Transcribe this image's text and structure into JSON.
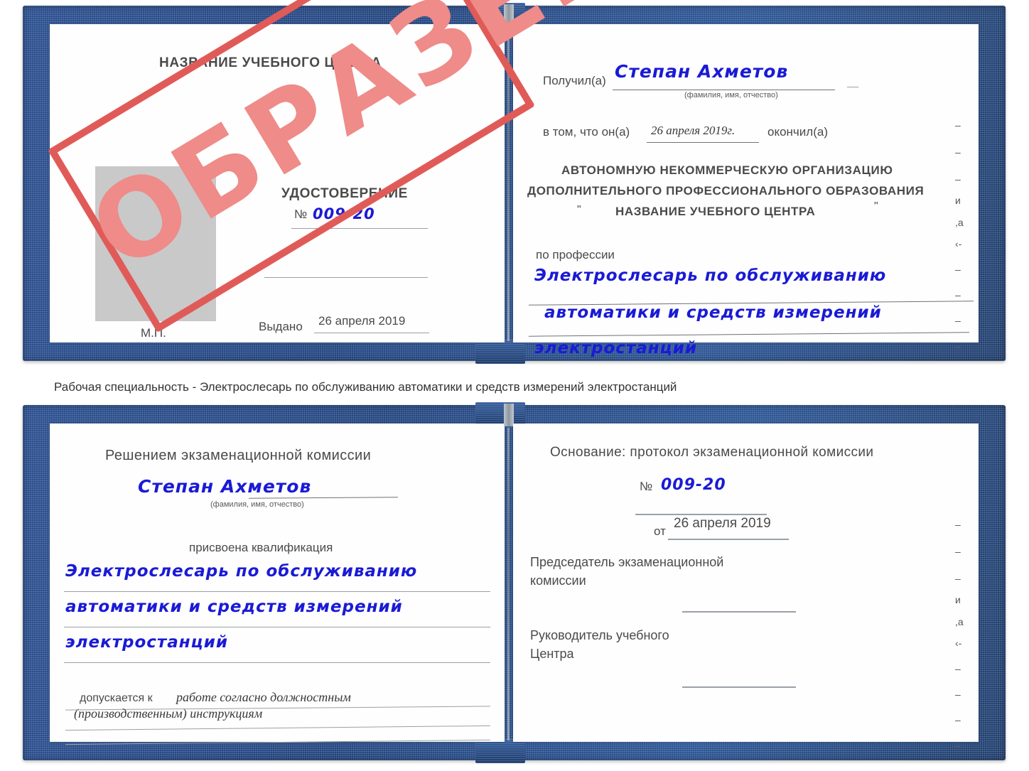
{
  "document": {
    "type": "certificate-sample-image",
    "watermark": "ОБРАЗЕЦ",
    "accent_blue_cover": "#2b4f8f",
    "handwriting_blue": "#1a1ad6",
    "stamp_red": "#e05b58",
    "photo_placeholder_gray": "#c9c9c9"
  },
  "certificate_top": {
    "left_page": {
      "center_name": "НАЗВАНИЕ УЧЕБНОГО ЦЕНТРА",
      "title": "УДОСТОВЕРЕНИЕ",
      "number_label": "№",
      "number_value": "009-20",
      "issued_label": "Выдано",
      "issued_value": "26 апреля 2019",
      "seal_label": "М.П."
    },
    "right_page": {
      "received_label": "Получил(а)",
      "received_value": "Степан Ахметов",
      "fio_hint": "(фамилия, имя, отчество)",
      "that_he_label": "в том, что он(а)",
      "finished_date": "26 апреля 2019г.",
      "finished_label": "окончил(а)",
      "org_line1": "АВТОНОМНУЮ НЕКОММЕРЧЕСКУЮ ОРГАНИЗАЦИЮ",
      "org_line2": "ДОПОЛНИТЕЛЬНОГО ПРОФЕССИОНАЛЬНОГО ОБРАЗОВАНИЯ",
      "org_quote_open": "\"",
      "org_line3": "НАЗВАНИЕ УЧЕБНОГО ЦЕНТРА",
      "org_quote_close": "\"",
      "profession_label": "по профессии",
      "profession_line1": "Электрослесарь по обслуживанию",
      "profession_line2": "автоматики и средств измерений",
      "profession_line3": "электростанций"
    },
    "edge_marks": [
      "–",
      "–",
      "–",
      "и",
      ",а",
      "‹-",
      "–",
      "–",
      "–",
      "–"
    ]
  },
  "caption": "Рабочая специальность - Электрослесарь по обслуживанию автоматики и средств измерений электростанций",
  "certificate_bottom": {
    "left_page": {
      "heading": "Решением экзаменационной комиссии",
      "name_value": "Степан Ахметов",
      "fio_hint": "(фамилия, имя, отчество)",
      "qualification_label": "присвоена квалификация",
      "qualification_line1": "Электрослесарь по обслуживанию",
      "qualification_line2": "автоматики и средств измерений",
      "qualification_line3": "электростанций",
      "allowed_label": "допускается к",
      "allowed_line1": "работе согласно должностным",
      "allowed_line2": "(производственным) инструкциям"
    },
    "right_page": {
      "basis_label": "Основание: протокол экзаменационной комиссии",
      "number_label": "№",
      "number_value": "009-20",
      "date_label": "от",
      "date_value": "26 апреля 2019",
      "chairman_line1": "Председатель экзаменационной",
      "chairman_line2": "комиссии",
      "head_line1": "Руководитель учебного",
      "head_line2": "Центра"
    },
    "edge_marks": [
      "–",
      "–",
      "–",
      "и",
      ",а",
      "‹-",
      "–",
      "–",
      "–",
      "–"
    ]
  }
}
